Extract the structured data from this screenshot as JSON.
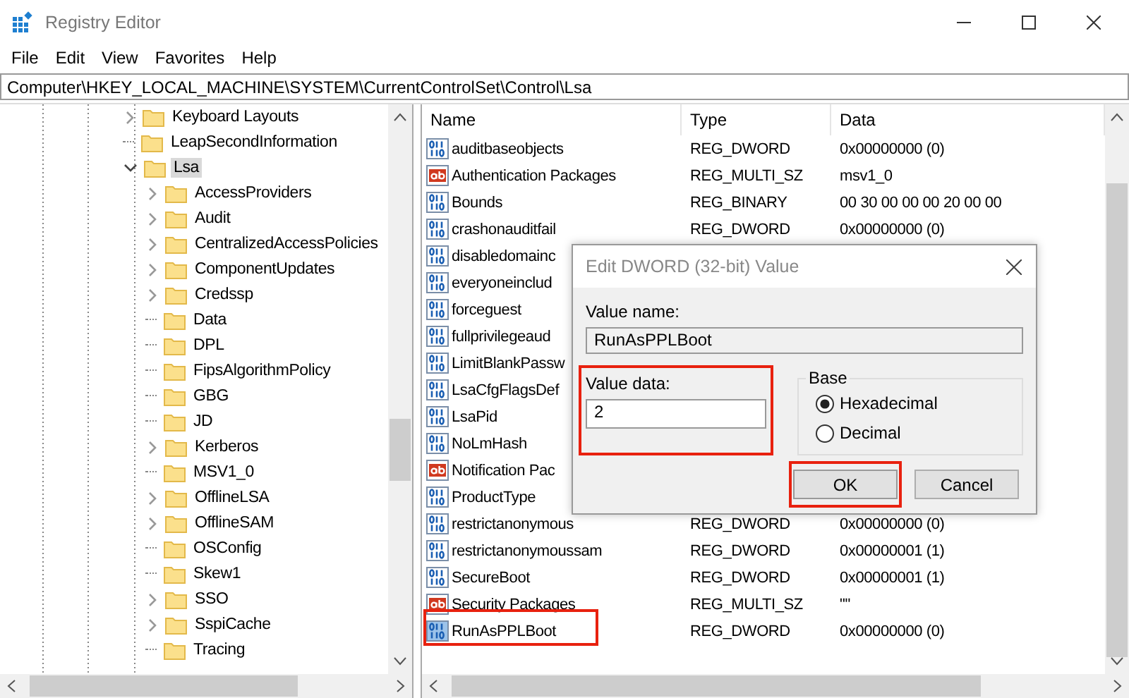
{
  "window": {
    "title": "Registry Editor"
  },
  "menu": [
    "File",
    "Edit",
    "View",
    "Favorites",
    "Help"
  ],
  "address": "Computer\\HKEY_LOCAL_MACHINE\\SYSTEM\\CurrentControlSet\\Control\\Lsa",
  "tree": [
    {
      "label": "Keyboard Layouts",
      "expandable": true,
      "expanded": false,
      "selected": false
    },
    {
      "label": "LeapSecondInformation",
      "expandable": false,
      "selected": false
    },
    {
      "label": "Lsa",
      "expandable": true,
      "expanded": true,
      "selected": true,
      "children": [
        {
          "label": "AccessProviders",
          "expandable": true,
          "expanded": false,
          "selected": false
        },
        {
          "label": "Audit",
          "expandable": true,
          "expanded": false,
          "selected": false
        },
        {
          "label": "CentralizedAccessPolicies",
          "expandable": true,
          "expanded": false,
          "selected": false
        },
        {
          "label": "ComponentUpdates",
          "expandable": true,
          "expanded": false,
          "selected": false
        },
        {
          "label": "Credssp",
          "expandable": true,
          "expanded": false,
          "selected": false
        },
        {
          "label": "Data",
          "expandable": false,
          "selected": false
        },
        {
          "label": "DPL",
          "expandable": false,
          "selected": false
        },
        {
          "label": "FipsAlgorithmPolicy",
          "expandable": false,
          "selected": false
        },
        {
          "label": "GBG",
          "expandable": false,
          "selected": false
        },
        {
          "label": "JD",
          "expandable": false,
          "selected": false
        },
        {
          "label": "Kerberos",
          "expandable": true,
          "expanded": false,
          "selected": false
        },
        {
          "label": "MSV1_0",
          "expandable": false,
          "selected": false
        },
        {
          "label": "OfflineLSA",
          "expandable": true,
          "expanded": false,
          "selected": false
        },
        {
          "label": "OfflineSAM",
          "expandable": true,
          "expanded": false,
          "selected": false
        },
        {
          "label": "OSConfig",
          "expandable": false,
          "selected": false
        },
        {
          "label": "Skew1",
          "expandable": false,
          "selected": false
        },
        {
          "label": "SSO",
          "expandable": true,
          "expanded": false,
          "selected": false
        },
        {
          "label": "SspiCache",
          "expandable": true,
          "expanded": false,
          "selected": false
        },
        {
          "label": "Tracing",
          "expandable": false,
          "selected": false
        }
      ]
    }
  ],
  "table": {
    "columns": [
      "Name",
      "Type",
      "Data"
    ],
    "rows": [
      {
        "kind": "binary",
        "name": "auditbaseobjects",
        "type": "REG_DWORD",
        "data": "0x00000000 (0)",
        "selected": false,
        "highlighted": false
      },
      {
        "kind": "string",
        "name": "Authentication Packages",
        "type": "REG_MULTI_SZ",
        "data": "msv1_0",
        "selected": false,
        "highlighted": false
      },
      {
        "kind": "binary",
        "name": "Bounds",
        "type": "REG_BINARY",
        "data": "00 30 00 00 00 20 00 00",
        "selected": false,
        "highlighted": false
      },
      {
        "kind": "binary",
        "name": "crashonauditfail",
        "type": "REG_DWORD",
        "data": "0x00000000 (0)",
        "selected": false,
        "highlighted": false
      },
      {
        "kind": "binary",
        "name": "disabledomainc",
        "selected": false,
        "highlighted": false
      },
      {
        "kind": "binary",
        "name": "everyoneinclud",
        "selected": false,
        "highlighted": false
      },
      {
        "kind": "binary",
        "name": "forceguest",
        "selected": false,
        "highlighted": false
      },
      {
        "kind": "binary",
        "name": "fullprivilegeaud",
        "selected": false,
        "highlighted": false
      },
      {
        "kind": "binary",
        "name": "LimitBlankPassw",
        "selected": false,
        "highlighted": false
      },
      {
        "kind": "binary",
        "name": "LsaCfgFlagsDef",
        "selected": false,
        "highlighted": false
      },
      {
        "kind": "binary",
        "name": "LsaPid",
        "selected": false,
        "highlighted": false
      },
      {
        "kind": "binary",
        "name": "NoLmHash",
        "selected": false,
        "highlighted": false
      },
      {
        "kind": "string",
        "name": "Notification Pac",
        "selected": false,
        "highlighted": false
      },
      {
        "kind": "binary",
        "name": "ProductType",
        "selected": false,
        "highlighted": false
      },
      {
        "kind": "binary",
        "name": "restrictanonymous",
        "type": "REG_DWORD",
        "data": "0x00000000 (0)",
        "selected": false,
        "highlighted": false
      },
      {
        "kind": "binary",
        "name": "restrictanonymoussam",
        "type": "REG_DWORD",
        "data": "0x00000001 (1)",
        "selected": false,
        "highlighted": false
      },
      {
        "kind": "binary",
        "name": "SecureBoot",
        "type": "REG_DWORD",
        "data": "0x00000001 (1)",
        "selected": false,
        "highlighted": false
      },
      {
        "kind": "string",
        "name": "Security Packages",
        "type": "REG_MULTI_SZ",
        "data": "\"\"",
        "selected": false,
        "highlighted": false
      },
      {
        "kind": "binary",
        "name": "RunAsPPLBoot",
        "type": "REG_DWORD",
        "data": "0x00000000 (0)",
        "selected": true,
        "highlighted": true
      }
    ]
  },
  "dialog": {
    "title": "Edit DWORD (32-bit) Value",
    "value_name_label": "Value name:",
    "value_name": "RunAsPPLBoot",
    "value_data_label": "Value data:",
    "value_data": "2",
    "value_data_highlighted": true,
    "base_label": "Base",
    "base_options": [
      {
        "label": "Hexadecimal",
        "selected": true
      },
      {
        "label": "Decimal",
        "selected": false
      }
    ],
    "buttons": [
      {
        "label": "OK",
        "highlighted": true
      },
      {
        "label": "Cancel",
        "highlighted": false
      }
    ]
  }
}
